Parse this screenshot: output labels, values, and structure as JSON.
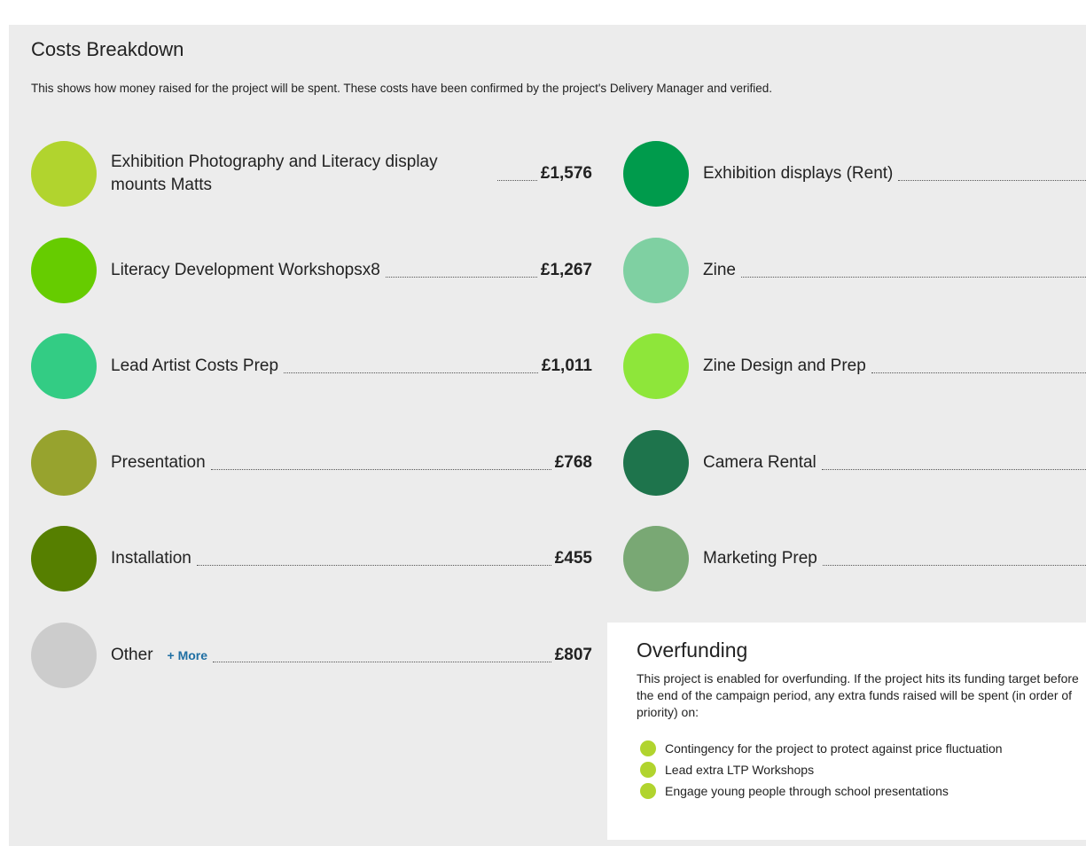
{
  "header": {
    "title": "Costs Breakdown",
    "description": "This shows how money raised for the project will be spent. These costs have been confirmed by the project's Delivery Manager and verified."
  },
  "left_items": [
    {
      "label": "Exhibition Photography and Literacy display mounts Matts",
      "amount": "£1,576",
      "color": "#b1d42e"
    },
    {
      "label": "Literacy Development Workshopsx8",
      "amount": "£1,267",
      "color": "#66cc00"
    },
    {
      "label": "Lead Artist Costs Prep",
      "amount": "£1,011",
      "color": "#33cc84"
    },
    {
      "label": "Presentation",
      "amount": "£768",
      "color": "#97a32e"
    },
    {
      "label": "Installation",
      "amount": "£455",
      "color": "#567f00"
    },
    {
      "label": "Other",
      "amount": "£807",
      "color": "#cccccc",
      "more": "+ More"
    }
  ],
  "right_items": [
    {
      "label": "Exhibition displays (Rent)",
      "color": "#009b4c"
    },
    {
      "label": "Zine",
      "color": "#7fd0a2"
    },
    {
      "label": "Zine Design and Prep",
      "color": "#8ee63a"
    },
    {
      "label": "Camera Rental",
      "color": "#1e744c"
    },
    {
      "label": "Marketing Prep",
      "color": "#79a874"
    }
  ],
  "overfunding": {
    "title": "Overfunding",
    "text": "This project is enabled for overfunding. If the project hits its funding target before the end of the campaign period, any extra funds raised will be spent (in order of priority) on:",
    "items": [
      "Contingency for the project to protect against price fluctuation",
      "Lead extra LTP Workshops",
      "Engage young people through school presentations"
    ],
    "bullet_color": "#b1d42e"
  }
}
